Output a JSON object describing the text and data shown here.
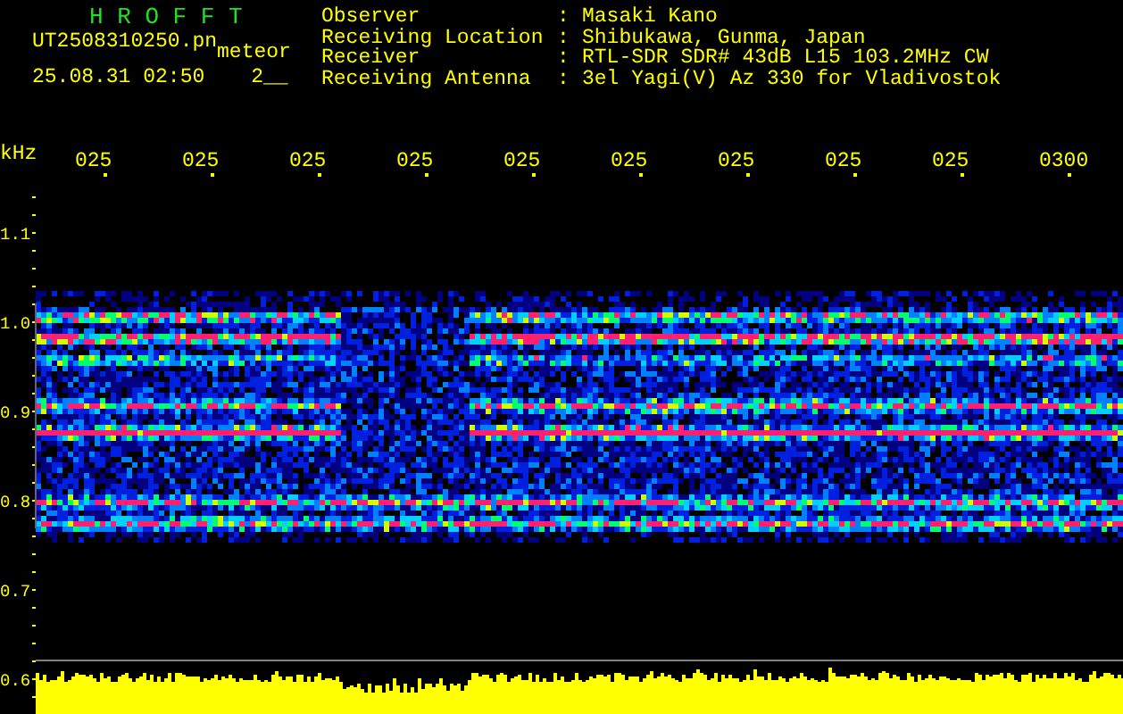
{
  "header": {
    "title": "H R O F F T",
    "filename": "UT2508310250.pn",
    "tag": "meteor",
    "datetime": "25.08.31 02:50",
    "code": "2__"
  },
  "info": [
    {
      "label": "Observer",
      "separator": ":",
      "value": "Masaki Kano"
    },
    {
      "label": "Receiving Location",
      "separator": ":",
      "value": "Shibukawa, Gunma, Japan"
    },
    {
      "label": "Receiver",
      "separator": ":",
      "value": "RTL-SDR SDR# 43dB L15 103.2MHz CW"
    },
    {
      "label": "Receiving Antenna",
      "separator": ":",
      "value": "3el Yagi(V) Az 330 for Vladivostok"
    }
  ],
  "plot": {
    "unit": "kHz",
    "time_labels": [
      "025",
      "025",
      "025",
      "025",
      "025",
      "025",
      "025",
      "025",
      "025",
      "0300"
    ],
    "freq_labels": [
      "1.1",
      "1.0",
      "0.9",
      "0.8",
      "0.7",
      "0.6"
    ]
  }
}
